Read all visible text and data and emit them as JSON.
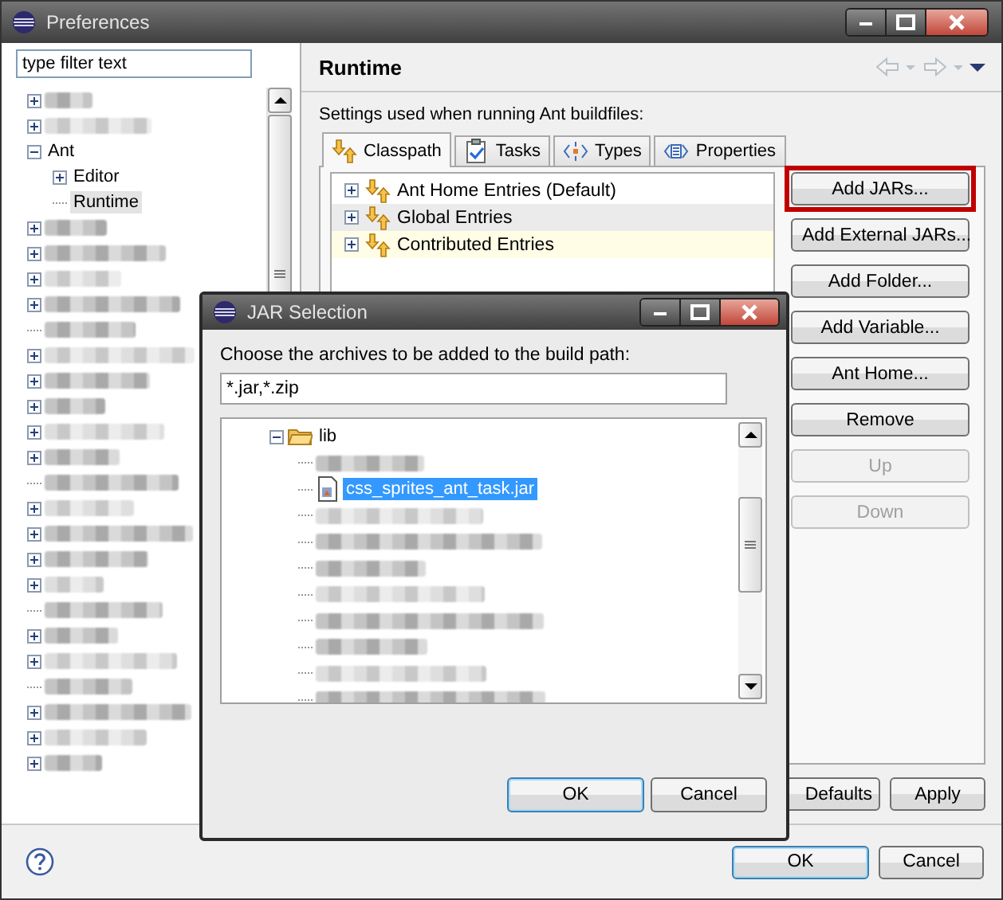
{
  "window": {
    "title": "Preferences"
  },
  "filter": {
    "placeholder": "type filter text"
  },
  "nav_tree": [
    {
      "kind": "blurred",
      "expanded": false,
      "selected": false
    },
    {
      "kind": "blurred",
      "expanded": false,
      "selected": false
    },
    {
      "kind": "item",
      "label": "Ant",
      "expanded": true,
      "selected": false,
      "children": [
        {
          "kind": "item",
          "label": "Editor",
          "expanded": false,
          "selected": false
        },
        {
          "kind": "item",
          "label": "Runtime",
          "selected": true
        }
      ]
    },
    {
      "kind": "blurred",
      "expanded": false,
      "selected": false
    },
    {
      "kind": "blurred",
      "expanded": false,
      "selected": false
    },
    {
      "kind": "blurred",
      "expanded": false,
      "selected": false
    },
    {
      "kind": "blurred",
      "expanded": false,
      "selected": false
    },
    {
      "kind": "blurred",
      "selected": false
    },
    {
      "kind": "blurred",
      "expanded": false,
      "selected": false
    },
    {
      "kind": "blurred",
      "expanded": false,
      "selected": false
    },
    {
      "kind": "blurred",
      "expanded": false,
      "selected": false
    },
    {
      "kind": "blurred",
      "expanded": false,
      "selected": false
    },
    {
      "kind": "blurred",
      "expanded": false,
      "selected": false
    },
    {
      "kind": "blurred",
      "selected": false
    },
    {
      "kind": "blurred",
      "expanded": false,
      "selected": false
    },
    {
      "kind": "blurred",
      "expanded": false,
      "selected": false
    },
    {
      "kind": "blurred",
      "expanded": false,
      "selected": false
    },
    {
      "kind": "blurred",
      "expanded": false,
      "selected": false
    },
    {
      "kind": "blurred",
      "selected": false
    },
    {
      "kind": "blurred",
      "expanded": false,
      "selected": false
    },
    {
      "kind": "blurred",
      "expanded": false,
      "selected": false
    },
    {
      "kind": "blurred",
      "selected": false
    },
    {
      "kind": "blurred",
      "expanded": false,
      "selected": false
    },
    {
      "kind": "blurred",
      "expanded": false,
      "selected": false
    },
    {
      "kind": "blurred",
      "expanded": false,
      "selected": false
    }
  ],
  "page": {
    "title": "Runtime",
    "description": "Settings used when running Ant buildfiles:",
    "tabs": [
      {
        "label": "Classpath",
        "selected": true
      },
      {
        "label": "Tasks",
        "selected": false
      },
      {
        "label": "Types",
        "selected": false
      },
      {
        "label": "Properties",
        "selected": false
      }
    ],
    "classpath": [
      {
        "label": "Ant Home Entries (Default)",
        "expanded": false,
        "selected": false,
        "hovered": false
      },
      {
        "label": "Global Entries",
        "expanded": false,
        "selected": true,
        "hovered": false
      },
      {
        "label": "Contributed Entries",
        "expanded": false,
        "selected": false,
        "hovered": true
      }
    ],
    "buttons": [
      {
        "label": "Add JARs...",
        "disabled": false,
        "highlighted": true
      },
      {
        "label": "Add External JARs...",
        "disabled": false,
        "highlighted": false
      },
      {
        "label": "Add Folder...",
        "disabled": false,
        "highlighted": false
      },
      {
        "label": "Add Variable...",
        "disabled": false,
        "highlighted": false
      },
      {
        "label": "Ant Home...",
        "disabled": false,
        "highlighted": false
      },
      {
        "label": "Remove",
        "disabled": false,
        "highlighted": false
      },
      {
        "label": "Up",
        "disabled": true,
        "highlighted": false
      },
      {
        "label": "Down",
        "disabled": true,
        "highlighted": false
      }
    ],
    "defaults_button": "Defaults",
    "apply_button": "Apply"
  },
  "footer": {
    "buttons": [
      {
        "label": "OK",
        "default": true
      },
      {
        "label": "Cancel",
        "default": false
      }
    ]
  },
  "dialog": {
    "title": "JAR Selection",
    "prompt": "Choose the archives to be added to the build path:",
    "filter_value": "*.jar,*.zip",
    "tree": [
      {
        "kind": "folder",
        "label": "lib",
        "expanded": true,
        "selected": false,
        "children": [
          {
            "kind": "blurred",
            "selected": false
          },
          {
            "kind": "jar",
            "label": "css_sprites_ant_task.jar",
            "selected": true
          },
          {
            "kind": "blurred",
            "selected": false
          },
          {
            "kind": "blurred",
            "selected": false
          },
          {
            "kind": "blurred",
            "selected": false
          },
          {
            "kind": "blurred",
            "selected": false
          },
          {
            "kind": "blurred",
            "selected": false
          },
          {
            "kind": "blurred",
            "selected": false
          },
          {
            "kind": "blurred",
            "selected": false
          },
          {
            "kind": "blurred",
            "selected": false
          }
        ]
      }
    ],
    "buttons": [
      {
        "label": "OK",
        "default": true
      },
      {
        "label": "Cancel",
        "default": false
      }
    ]
  }
}
